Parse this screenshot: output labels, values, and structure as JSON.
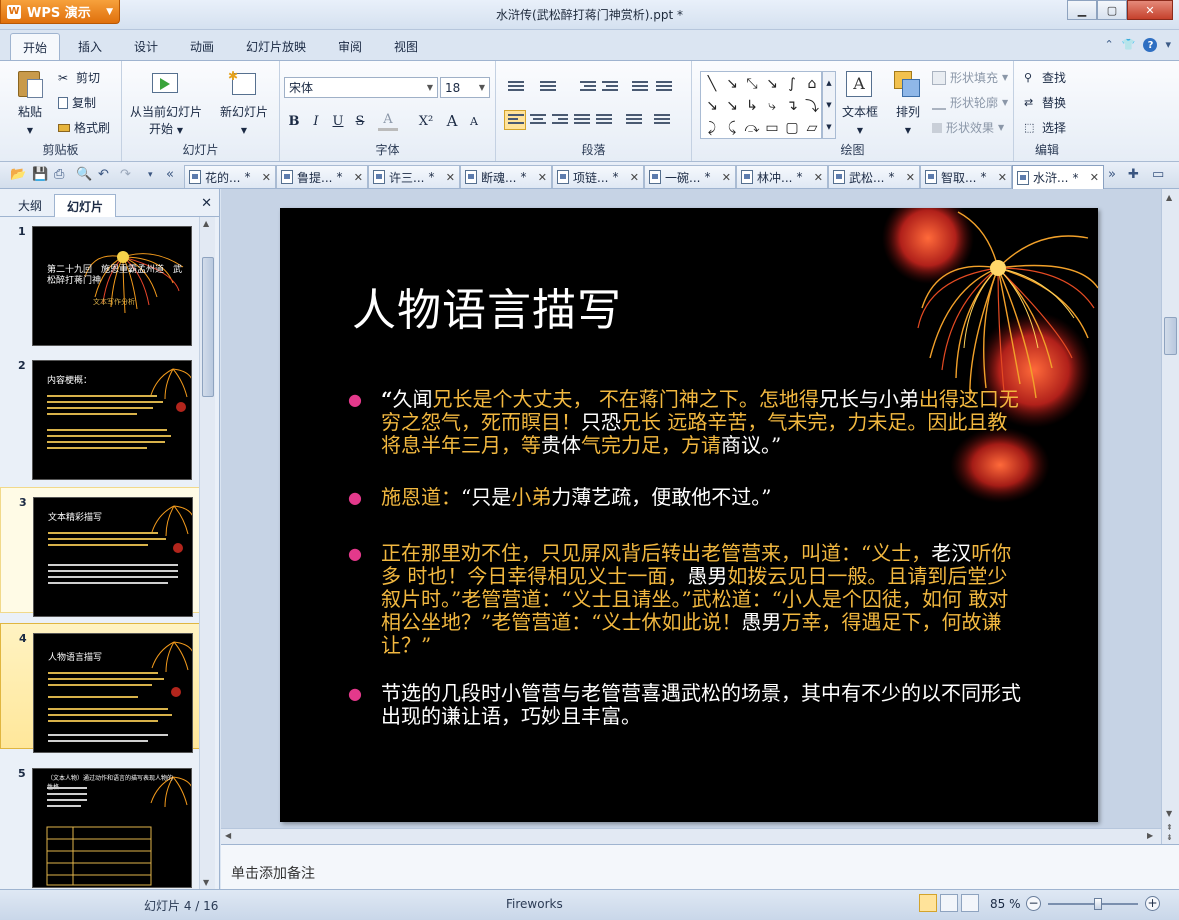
{
  "app": {
    "menu_label": "WPS 演示",
    "window_title": "水浒传(武松醉打蒋门神赏析).ppt *",
    "window_controls": [
      "minimize",
      "maximize",
      "close"
    ]
  },
  "ribbon_tabs": [
    {
      "label": "开始",
      "active": true
    },
    {
      "label": "插入"
    },
    {
      "label": "设计"
    },
    {
      "label": "动画"
    },
    {
      "label": "幻灯片放映"
    },
    {
      "label": "审阅"
    },
    {
      "label": "视图"
    }
  ],
  "ribbon": {
    "clipboard": {
      "label": "剪贴板",
      "paste": "粘贴",
      "cut": "剪切",
      "copy": "复制",
      "format_painter": "格式刷"
    },
    "slides": {
      "label": "幻灯片",
      "play_from_current": "从当前幻灯片",
      "play_from_current_2": "开始",
      "new_slide": "新幻灯片"
    },
    "font": {
      "label": "字体",
      "font_name": "宋体",
      "font_size": "18",
      "bold": "B",
      "italic": "I",
      "underline": "U",
      "strike": "S",
      "color": "A",
      "superscript": "X²",
      "grow": "A",
      "shrink": "A"
    },
    "paragraph": {
      "label": "段落"
    },
    "drawing": {
      "label": "绘图",
      "textbox": "文本框",
      "arrange": "排列",
      "shape_fill": "形状填充",
      "shape_outline": "形状轮廓",
      "shape_effect": "形状效果"
    },
    "editing": {
      "label": "编辑",
      "find": "查找",
      "replace": "替换",
      "select": "选择"
    }
  },
  "doc_tabs": [
    {
      "label": "花的..."
    },
    {
      "label": "鲁提..."
    },
    {
      "label": "许三..."
    },
    {
      "label": "断魂..."
    },
    {
      "label": "项链..."
    },
    {
      "label": "一碗..."
    },
    {
      "label": "林冲..."
    },
    {
      "label": "武松..."
    },
    {
      "label": "智取..."
    },
    {
      "label": "水浒...",
      "active": true
    }
  ],
  "doc_tab_mark": "*",
  "left_panel": {
    "tabs": [
      {
        "label": "大纲"
      },
      {
        "label": "幻灯片",
        "active": true
      }
    ],
    "thumbnails": [
      {
        "num": "1",
        "title": "第二十九回　施恩重霸孟州道　武松醉打蒋门神",
        "subtitle": "文本写作分析"
      },
      {
        "num": "2",
        "title": "内容梗概："
      },
      {
        "num": "3",
        "title": "文本精彩描写"
      },
      {
        "num": "4",
        "title": "人物语言描写"
      },
      {
        "num": "5",
        "title": "（文本人物）通过动作和语言的描写表现人物的性格"
      }
    ]
  },
  "slide": {
    "title": "人物语言描写",
    "bullets": [
      {
        "quote": "“",
        "p1": "久闻",
        "p2": "兄长是个大丈夫，",
        "p3": " 不在蒋门神之下。怎地得",
        "p4": "兄长与小弟",
        "p5": "出得这口无穷之怨气，死而瞑目！",
        "p6": "只恐",
        "p7": "兄长",
        "p8": " 远路辛苦，气未完，力未足。因此且教将息半年三月，等",
        "p9": "贵体",
        "p10": "气完力足，方请",
        "p11": "商议。”"
      },
      {
        "p1": "施恩道：",
        "p2": "“只是",
        "p3": "小弟",
        "p4": "力薄艺疏，便敢他不过。”"
      },
      {
        "p1": "正在那里劝不住，只见屏风背后转出老管营来，叫道：“义士，",
        "p2": "老汉",
        "p3": "听你多 时也！今日幸得相见义士一面，",
        "p4": "愚男",
        "p5": "如拨云见日一般。且请到后堂少叙片时。”老管营道：“义士且请坐。”武松道：“小人是个囚徒，如何 敢对相公坐地？”老管营道：“义士休如此说！",
        "p6": "愚男",
        "p7": "万幸，得遇足下，何故谦让？”"
      },
      {
        "p1": "节选的几段时小管营与老管营喜遇武松的场景，其中有不少的以不同形式出现的谦让语，巧妙且丰富。"
      }
    ]
  },
  "notes_placeholder": "单击添加备注",
  "status": {
    "slide_indicator": "幻灯片 4 / 16",
    "theme": "Fireworks",
    "zoom": "85 %",
    "zoom_fraction": 0.55
  },
  "colors": {
    "accent": "#e0700c",
    "slide_bg": "#000000",
    "highlight": "#f2b840",
    "bullet": "#e3398b"
  }
}
